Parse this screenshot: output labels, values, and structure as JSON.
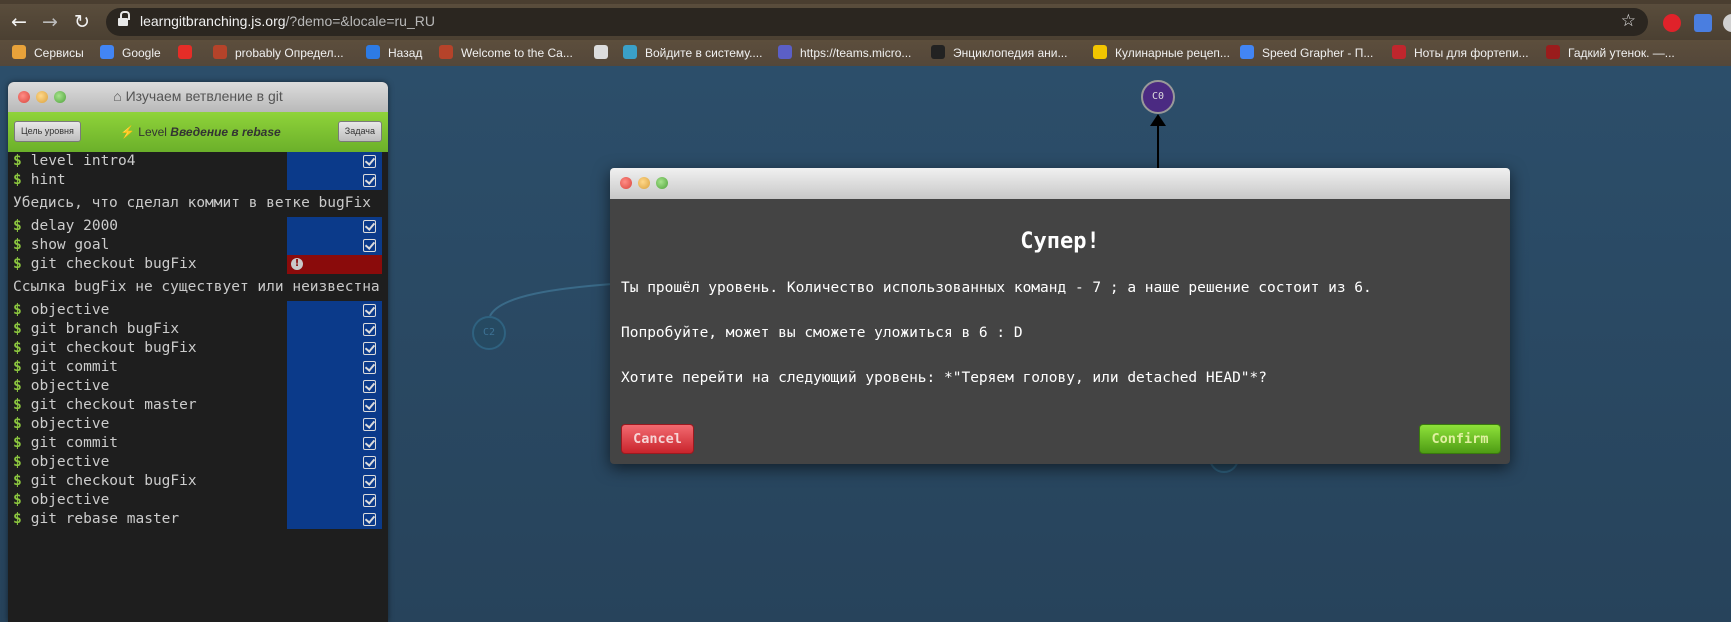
{
  "browser": {
    "url_host": "learngitbranching.js.org",
    "url_rest": "/?demo=&locale=ru_RU",
    "nav": {
      "back": "←",
      "forward": "→",
      "reload": "↻",
      "star": "☆"
    },
    "bookmarks": [
      {
        "label": "Сервисы",
        "icon_color": "#e8a23a"
      },
      {
        "label": "Google",
        "icon_color": "#4285f4"
      },
      {
        "label": "",
        "icon_color": "#e52d27"
      },
      {
        "label": "probably Определ...",
        "icon_color": "#b5432a"
      },
      {
        "label": "Назад",
        "icon_color": "#2d7be5"
      },
      {
        "label": "Welcome to the Ca...",
        "icon_color": "#b5432a"
      },
      {
        "label": "",
        "icon_color": "#dddddd"
      },
      {
        "label": "Войдите в систему....",
        "icon_color": "#3aa0c8"
      },
      {
        "label": "https://teams.micro...",
        "icon_color": "#5b5fc7"
      },
      {
        "label": "Энциклопедия ани...",
        "icon_color": "#222222"
      },
      {
        "label": "Кулинарные рецеп...",
        "icon_color": "#f2c500"
      },
      {
        "label": "Speed Grapher - П...",
        "icon_color": "#4285f4"
      },
      {
        "label": "Ноты для фортепи...",
        "icon_color": "#c0262d"
      },
      {
        "label": "Гадкий утенок. —...",
        "icon_color": "#9a1c1c"
      }
    ]
  },
  "panel": {
    "title": "Изучаем ветвление в git",
    "home_icon": "⌂",
    "goal_button": "Цель уровня",
    "level_prefix": "⚡ Level ",
    "level_name": "Введение в rebase",
    "task_button": "Задача",
    "lines": [
      {
        "kind": "cmd",
        "text": "level intro4",
        "status": "ok"
      },
      {
        "kind": "cmd",
        "text": "hint",
        "status": "ok"
      },
      {
        "kind": "msg",
        "text": "Убедись, что сделал коммит в ветке bugFix"
      },
      {
        "kind": "cmd",
        "text": "delay 2000",
        "status": "ok"
      },
      {
        "kind": "cmd",
        "text": "show goal",
        "status": "ok"
      },
      {
        "kind": "cmd",
        "text": "git checkout bugFix",
        "status": "error"
      },
      {
        "kind": "msg",
        "text": "Ссылка bugFix не существует или неизвестна"
      },
      {
        "kind": "cmd",
        "text": "objective",
        "status": "ok"
      },
      {
        "kind": "cmd",
        "text": "git branch bugFix",
        "status": "ok"
      },
      {
        "kind": "cmd",
        "text": "git checkout bugFix",
        "status": "ok"
      },
      {
        "kind": "cmd",
        "text": "git commit",
        "status": "ok"
      },
      {
        "kind": "cmd",
        "text": "objective",
        "status": "ok"
      },
      {
        "kind": "cmd",
        "text": "git checkout master",
        "status": "ok"
      },
      {
        "kind": "cmd",
        "text": "objective",
        "status": "ok"
      },
      {
        "kind": "cmd",
        "text": "git commit",
        "status": "ok"
      },
      {
        "kind": "cmd",
        "text": "objective",
        "status": "ok"
      },
      {
        "kind": "cmd",
        "text": "git checkout bugFix",
        "status": "ok"
      },
      {
        "kind": "cmd",
        "text": "objective",
        "status": "ok"
      },
      {
        "kind": "cmd",
        "text": "git rebase master",
        "status": "ok"
      }
    ]
  },
  "graph": {
    "top_node": "C0",
    "ghost_node": "C2"
  },
  "dialog": {
    "heading": "Супер!",
    "line1": "Ты прошёл уровень. Количество использованных команд - 7 ; а наше решение состоит из 6.",
    "line2": "Попробуйте, может вы сможете уложиться в 6 : D",
    "line3": "Хотите перейти на следующий уровень: *\"Теряем голову, или detached HEAD\"*?",
    "cancel": "Cancel",
    "confirm": "Confirm"
  }
}
